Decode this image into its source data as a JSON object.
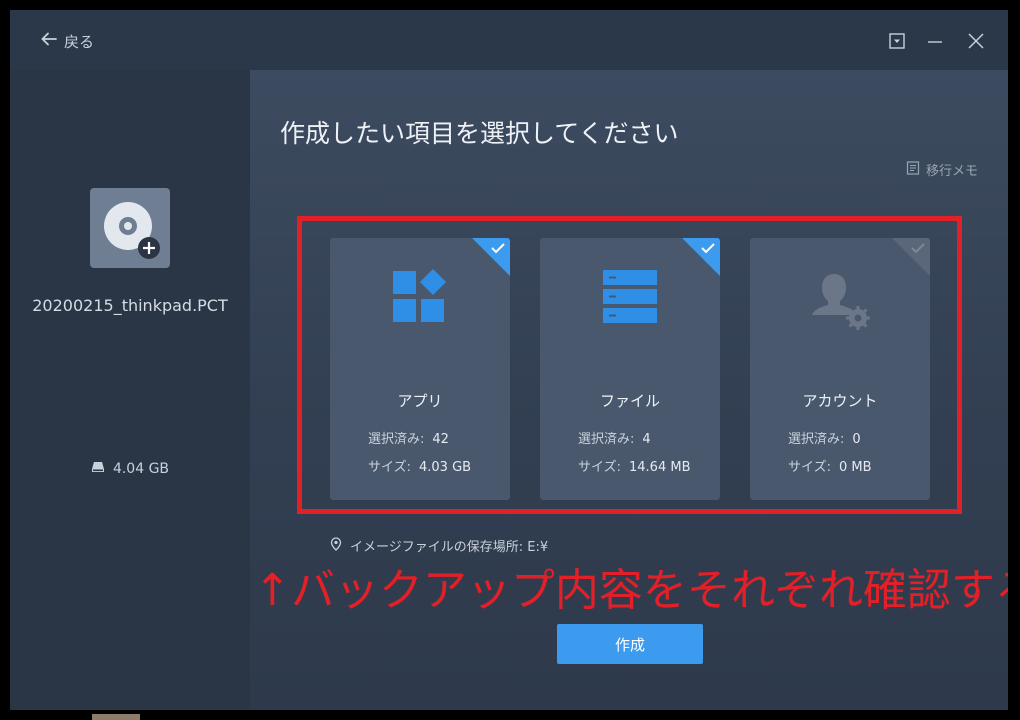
{
  "window": {
    "back_label": "戻る"
  },
  "sidebar": {
    "backup_name": "20200215_thinkpad.PCT",
    "total_size": "4.04 GB"
  },
  "main": {
    "title": "作成したい項目を選択してください",
    "memo_label": "移行メモ",
    "location_text": "イメージファイルの保存場所: E:¥",
    "create_button": "作成",
    "annotation": "↑バックアップ内容をそれぞれ確認する"
  },
  "cards": [
    {
      "title": "アプリ",
      "selected_label": "選択済み:",
      "selected_value": "42",
      "size_label": "サイズ:",
      "size_value": "4.03 GB",
      "checked": true,
      "icon": "apps-icon"
    },
    {
      "title": "ファイル",
      "selected_label": "選択済み:",
      "selected_value": "4",
      "size_label": "サイズ:",
      "size_value": "14.64 MB",
      "checked": true,
      "icon": "files-icon"
    },
    {
      "title": "アカウント",
      "selected_label": "選択済み:",
      "selected_value": "0",
      "size_label": "サイズ:",
      "size_value": "0 MB",
      "checked": false,
      "icon": "account-settings-icon"
    }
  ],
  "colors": {
    "accent": "#3d9bef",
    "icon_blue": "#2f8fe6",
    "annotation_red": "#e32027"
  }
}
